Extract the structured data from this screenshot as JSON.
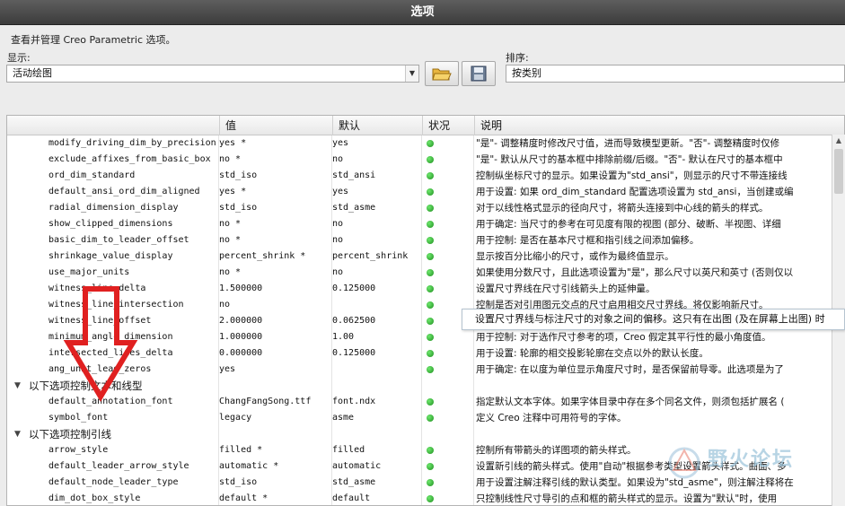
{
  "window": {
    "title": "选项"
  },
  "description": "查看并管理 Creo Parametric 选项。",
  "display": {
    "label": "显示:",
    "value": "活动绘图"
  },
  "sort": {
    "label": "排序:",
    "value": "按类别"
  },
  "toolbar": {
    "open_icon": "folder-open-icon",
    "save_icon": "save-icon"
  },
  "columns": {
    "name": "",
    "value": "值",
    "default": "默认",
    "status": "状况",
    "description": "说明"
  },
  "rows": [
    {
      "name": "modify_driving_dim_by_precision",
      "value": "yes *",
      "default": "yes",
      "desc": "\"是\"- 调整精度时修改尺寸值，进而导致模型更新。\"否\"- 调整精度时仅修"
    },
    {
      "name": "exclude_affixes_from_basic_box",
      "value": "no *",
      "default": "no",
      "desc": "\"是\"- 默认从尺寸的基本框中排除前缀/后缀。\"否\"- 默认在尺寸的基本框中"
    },
    {
      "name": "ord_dim_standard",
      "value": "std_iso",
      "default": "std_ansi",
      "desc": "控制纵坐标尺寸的显示。如果设置为\"std_ansi\"，则显示的尺寸不带连接线"
    },
    {
      "name": "default_ansi_ord_dim_aligned",
      "value": "yes *",
      "default": "yes",
      "desc": "用于设置: 如果 ord_dim_standard 配置选项设置为 std_ansi，当创建或编"
    },
    {
      "name": "radial_dimension_display",
      "value": "std_iso",
      "default": "std_asme",
      "desc": "对于以线性格式显示的径向尺寸，将箭头连接到中心线的箭头的样式。"
    },
    {
      "name": "show_clipped_dimensions",
      "value": "no *",
      "default": "no",
      "desc": "用于确定: 当尺寸的参考在可见度有限的视图 (部分、破断、半视图、详细"
    },
    {
      "name": "basic_dim_to_leader_offset",
      "value": "no *",
      "default": "no",
      "desc": "用于控制: 是否在基本尺寸框和指引线之间添加偏移。"
    },
    {
      "name": "shrinkage_value_display",
      "value": "percent_shrink *",
      "default": "percent_shrink",
      "desc": "显示按百分比缩小的尺寸，或作为最终值显示。"
    },
    {
      "name": "use_major_units",
      "value": "no *",
      "default": "no",
      "desc": "如果使用分数尺寸，且此选项设置为\"是\"，那么尺寸以英尺和英寸 (否则仅以"
    },
    {
      "name": "witness_line_delta",
      "value": "1.500000",
      "default": "0.125000",
      "desc": "设置尺寸界线在尺寸引线箭头上的延伸量。"
    },
    {
      "name": "witness_line_intersection",
      "value": "no",
      "default": "",
      "desc": "控制是否对引用图元交点的尺寸启用相交尺寸界线。将仅影响新尺寸。"
    },
    {
      "name": "witness_line_offset",
      "value": "2.000000",
      "default": "0.062500",
      "desc": ""
    },
    {
      "name": "minimum_angle_dimension",
      "value": "1.000000",
      "default": "1.00",
      "desc": "用于控制: 对于选作尺寸参考的项，Creo 假定其平行性的最小角度值。"
    },
    {
      "name": "intersected_lines_delta",
      "value": "0.000000",
      "default": "0.125000",
      "desc": "用于设置: 轮廓的相交投影轮廓在交点以外的默认长度。"
    },
    {
      "name": "ang_unit_lead_zeros",
      "value": "yes",
      "default": "",
      "desc": "用于确定: 在以度为单位显示角度尺寸时，是否保留前导零。此选项是为了"
    }
  ],
  "group_text": {
    "label": "以下选项控制文本和线型"
  },
  "rows_text": [
    {
      "name": "default_annotation_font",
      "value": "ChangFangSong.ttf",
      "default": "font.ndx",
      "desc": "指定默认文本字体。如果字体目录中存在多个同名文件，则须包括扩展名 ("
    },
    {
      "name": "symbol_font",
      "value": "legacy",
      "default": "asme",
      "desc": "定义 Creo 注释中可用符号的字体。"
    }
  ],
  "group_leader": {
    "label": "以下选项控制引线"
  },
  "rows_leader": [
    {
      "name": "arrow_style",
      "value": "filled *",
      "default": "filled",
      "desc": "控制所有带箭头的详图项的箭头样式。"
    },
    {
      "name": "default_leader_arrow_style",
      "value": "automatic *",
      "default": "automatic",
      "desc": "设置新引线的箭头样式。使用\"自动\"根据参考类型设置箭头样式。曲面、多"
    },
    {
      "name": "default_node_leader_type",
      "value": "std_iso",
      "default": "std_asme",
      "desc": "用于设置注解注释引线的默认类型。如果设为\"std_asme\"，则注解注释将在"
    },
    {
      "name": "dim_dot_box_style",
      "value": "default *",
      "default": "default",
      "desc": "只控制线性尺寸导引的点和框的箭头样式的显示。设置为\"默认\"时，使用"
    }
  ],
  "tooltip": "设置尺寸界线与标注尺寸的对象之间的偏移。这只有在出图 (及在屏幕上出图) 时",
  "watermark": "野火论坛"
}
